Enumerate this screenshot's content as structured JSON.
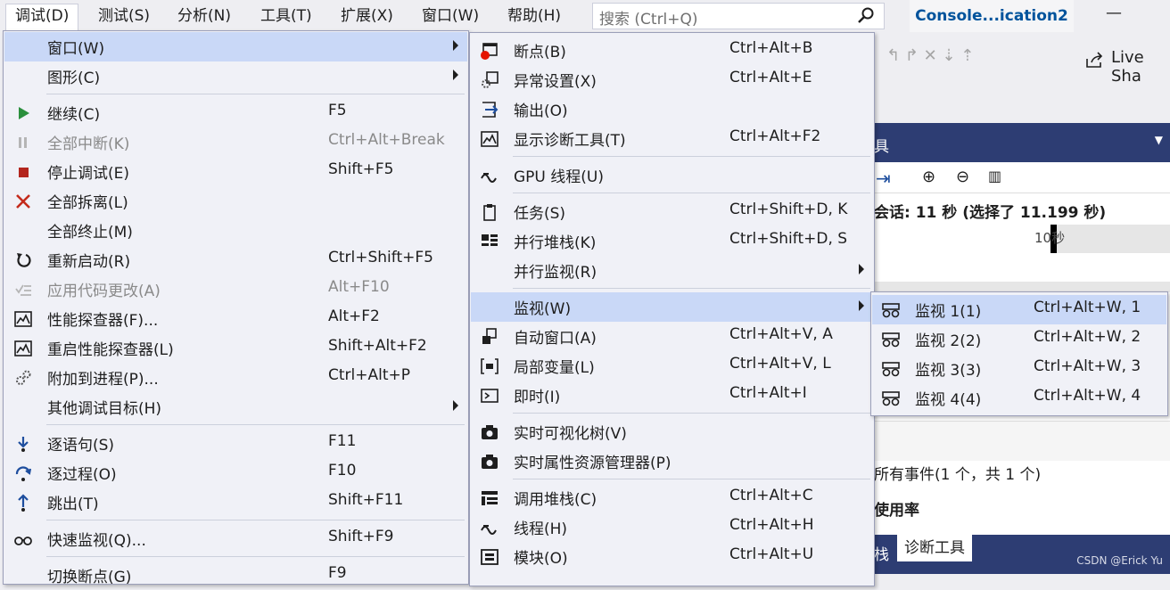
{
  "menubar": {
    "items": [
      "调试(D)",
      "测试(S)",
      "分析(N)",
      "工具(T)",
      "扩展(X)",
      "窗口(W)",
      "帮助(H)"
    ],
    "search_placeholder": "搜索 (Ctrl+Q)",
    "app_title": "Console...ication2"
  },
  "background": {
    "live_share": "Live Sha",
    "panel_title_fragment": "具",
    "session_text": "会话: 11 秒 (选择了 11.199 秒)",
    "ruler_label": "10秒",
    "events_text": "所有事件(1 个，共 1 个)",
    "usage_text": "使用率",
    "bottom_tab_fragment": "栈",
    "bottom_tab_active": "诊断工具"
  },
  "debug_menu": [
    {
      "label": "窗口(W)",
      "shortcut": "",
      "submenu": true,
      "highlight": true,
      "icon": ""
    },
    {
      "label": "图形(C)",
      "shortcut": "",
      "submenu": true,
      "icon": ""
    },
    {
      "label": "继续(C)",
      "shortcut": "F5",
      "icon": "play-icon"
    },
    {
      "label": "全部中断(K)",
      "shortcut": "Ctrl+Alt+Break",
      "disabled": true,
      "icon": "pause-icon"
    },
    {
      "label": "停止调试(E)",
      "shortcut": "Shift+F5",
      "icon": "stop-icon"
    },
    {
      "label": "全部拆离(L)",
      "shortcut": "",
      "icon": "detach-icon"
    },
    {
      "label": "全部终止(M)",
      "shortcut": "",
      "icon": ""
    },
    {
      "label": "重新启动(R)",
      "shortcut": "Ctrl+Shift+F5",
      "icon": "restart-icon"
    },
    {
      "label": "应用代码更改(A)",
      "shortcut": "Alt+F10",
      "disabled": true,
      "icon": "apply-changes-icon"
    },
    {
      "label": "性能探查器(F)...",
      "shortcut": "Alt+F2",
      "icon": "profiler-icon"
    },
    {
      "label": "重启性能探查器(L)",
      "shortcut": "Shift+Alt+F2",
      "icon": "profiler-icon"
    },
    {
      "label": "附加到进程(P)...",
      "shortcut": "Ctrl+Alt+P",
      "icon": "attach-process-icon"
    },
    {
      "label": "其他调试目标(H)",
      "shortcut": "",
      "submenu": true,
      "icon": ""
    },
    {
      "label": "逐语句(S)",
      "shortcut": "F11",
      "icon": "step-into-icon"
    },
    {
      "label": "逐过程(O)",
      "shortcut": "F10",
      "icon": "step-over-icon"
    },
    {
      "label": "跳出(T)",
      "shortcut": "Shift+F11",
      "icon": "step-out-icon"
    },
    {
      "label": "快速监视(Q)...",
      "shortcut": "Shift+F9",
      "icon": "quick-watch-icon"
    },
    {
      "label": "切换断点(G)",
      "shortcut": "F9",
      "icon": ""
    }
  ],
  "window_menu": [
    {
      "label": "断点(B)",
      "shortcut": "Ctrl+Alt+B",
      "icon": "breakpoints-icon"
    },
    {
      "label": "异常设置(X)",
      "shortcut": "Ctrl+Alt+E",
      "icon": "exception-settings-icon"
    },
    {
      "label": "输出(O)",
      "shortcut": "",
      "icon": "output-icon"
    },
    {
      "label": "显示诊断工具(T)",
      "shortcut": "Ctrl+Alt+F2",
      "icon": "diagnostic-tools-icon"
    },
    {
      "label": "GPU 线程(U)",
      "shortcut": "",
      "icon": "gpu-threads-icon"
    },
    {
      "label": "任务(S)",
      "shortcut": "Ctrl+Shift+D, K",
      "icon": "tasks-icon"
    },
    {
      "label": "并行堆栈(K)",
      "shortcut": "Ctrl+Shift+D, S",
      "icon": "parallel-stacks-icon"
    },
    {
      "label": "并行监视(R)",
      "shortcut": "",
      "submenu": true,
      "icon": ""
    },
    {
      "label": "监视(W)",
      "shortcut": "",
      "submenu": true,
      "highlight": true,
      "icon": ""
    },
    {
      "label": "自动窗口(A)",
      "shortcut": "Ctrl+Alt+V, A",
      "icon": "autos-icon"
    },
    {
      "label": "局部变量(L)",
      "shortcut": "Ctrl+Alt+V, L",
      "icon": "locals-icon"
    },
    {
      "label": "即时(I)",
      "shortcut": "Ctrl+Alt+I",
      "icon": "immediate-icon"
    },
    {
      "label": "实时可视化树(V)",
      "shortcut": "",
      "icon": "camera-icon"
    },
    {
      "label": "实时属性资源管理器(P)",
      "shortcut": "",
      "icon": "camera-icon"
    },
    {
      "label": "调用堆栈(C)",
      "shortcut": "Ctrl+Alt+C",
      "icon": "call-stack-icon"
    },
    {
      "label": "线程(H)",
      "shortcut": "Ctrl+Alt+H",
      "icon": "threads-icon"
    },
    {
      "label": "模块(O)",
      "shortcut": "Ctrl+Alt+U",
      "icon": "modules-icon"
    }
  ],
  "watch_menu": [
    {
      "label": "监视 1(1)",
      "shortcut": "Ctrl+Alt+W, 1",
      "highlight": true,
      "icon": "watch-icon"
    },
    {
      "label": "监视 2(2)",
      "shortcut": "Ctrl+Alt+W, 2",
      "icon": "watch-icon"
    },
    {
      "label": "监视 3(3)",
      "shortcut": "Ctrl+Alt+W, 3",
      "icon": "watch-icon"
    },
    {
      "label": "监视 4(4)",
      "shortcut": "Ctrl+Alt+W, 4",
      "icon": "watch-icon"
    }
  ],
  "watermark": "CSDN @Erick Yu"
}
